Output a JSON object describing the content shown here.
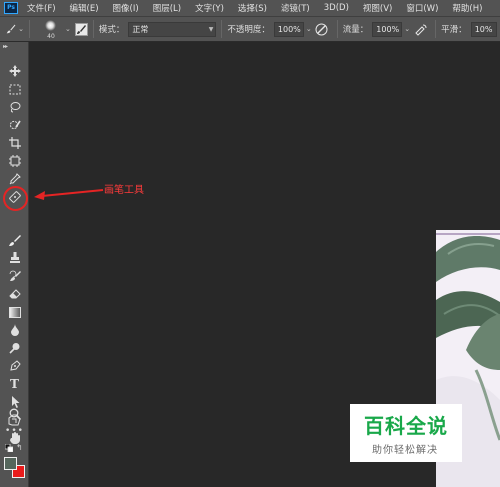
{
  "app": {
    "logo_text": "Ps"
  },
  "menu": [
    "文件(F)",
    "编辑(E)",
    "图像(I)",
    "图层(L)",
    "文字(Y)",
    "选择(S)",
    "滤镜(T)",
    "3D(D)",
    "视图(V)",
    "窗口(W)",
    "帮助(H)"
  ],
  "options": {
    "brush_size": "40",
    "mode_label": "模式：",
    "mode_value": "正常",
    "opacity_label": "不透明度：",
    "opacity_value": "100%",
    "flow_label": "流量：",
    "flow_value": "100%",
    "smoothing_label": "平滑：",
    "smoothing_value": "10%"
  },
  "tools": [
    "move-icon",
    "marquee-icon",
    "lasso-icon",
    "quick-select-icon",
    "crop-icon",
    "frame-icon",
    "eyedropper-icon",
    "healing-icon",
    "brush-icon",
    "clone-stamp-icon",
    "history-brush-icon",
    "eraser-icon",
    "gradient-icon",
    "blur-icon",
    "dodge-icon",
    "pen-icon",
    "type-icon",
    "path-select-icon",
    "shape-icon",
    "hand-icon",
    "zoom-icon",
    "more-icon"
  ],
  "colors": {
    "foreground": "#55665c",
    "background": "#e81b1b",
    "annotation": "#e52424",
    "watermark_green": "#19a84a"
  },
  "annotation": {
    "label": "画笔工具"
  },
  "watermark": {
    "title": "百科全说",
    "subtitle": "助你轻松解决"
  }
}
